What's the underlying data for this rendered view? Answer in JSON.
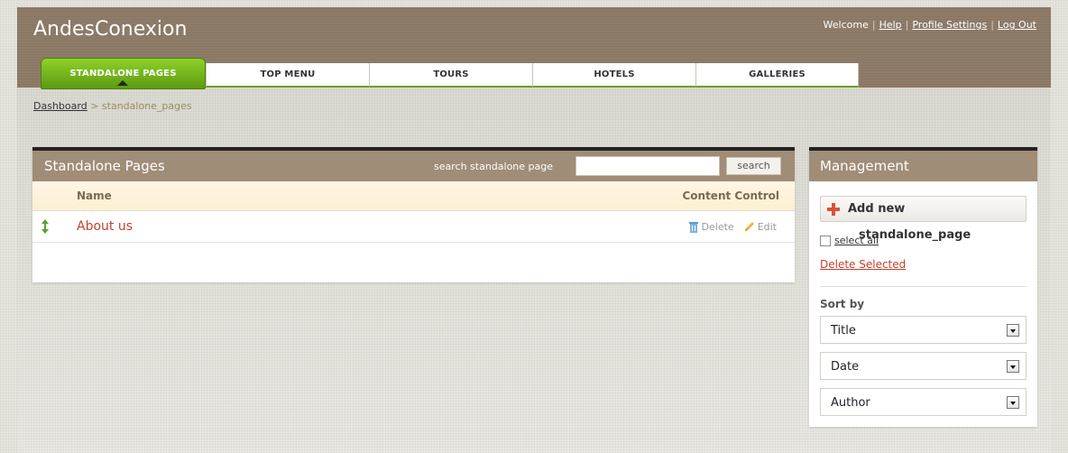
{
  "app": {
    "title": "AndesConexion"
  },
  "userbar": {
    "welcome": "Welcome",
    "help": "Help",
    "profile": "Profile Settings",
    "logout": "Log Out"
  },
  "nav": {
    "tabs": [
      {
        "label": "STANDALONE PAGES",
        "active": true
      },
      {
        "label": "TOP MENU"
      },
      {
        "label": "TOURS"
      },
      {
        "label": "HOTELS"
      },
      {
        "label": "GALLERIES"
      }
    ]
  },
  "breadcrumb": {
    "root": "Dashboard",
    "separator": ">",
    "current": "standalone_pages"
  },
  "main": {
    "title": "Standalone Pages",
    "search_label": "search standalone page",
    "search_value": "",
    "search_button": "search",
    "columns": {
      "name": "Name",
      "control": "Content Control"
    },
    "rows": [
      {
        "name": "About us",
        "delete": "Delete",
        "edit": "Edit"
      }
    ]
  },
  "management": {
    "title": "Management",
    "add_new": "Add new",
    "add_new_sub": "standalone_page",
    "select_all": "select all",
    "delete_selected": "Delete Selected",
    "sort_by": "Sort by",
    "sort_selects": [
      {
        "value": "Title"
      },
      {
        "value": "Date"
      },
      {
        "value": "Author"
      }
    ]
  },
  "colors": {
    "header": "#8e7c69",
    "panel_head": "#a08d77",
    "nav_active": "#6aa215",
    "link_red": "#c2402e"
  },
  "icons": {
    "sort": "up-down-arrow-icon",
    "delete": "trash-icon",
    "edit": "pencil-icon",
    "add": "plus-icon",
    "dropdown": "chevron-down-icon"
  }
}
